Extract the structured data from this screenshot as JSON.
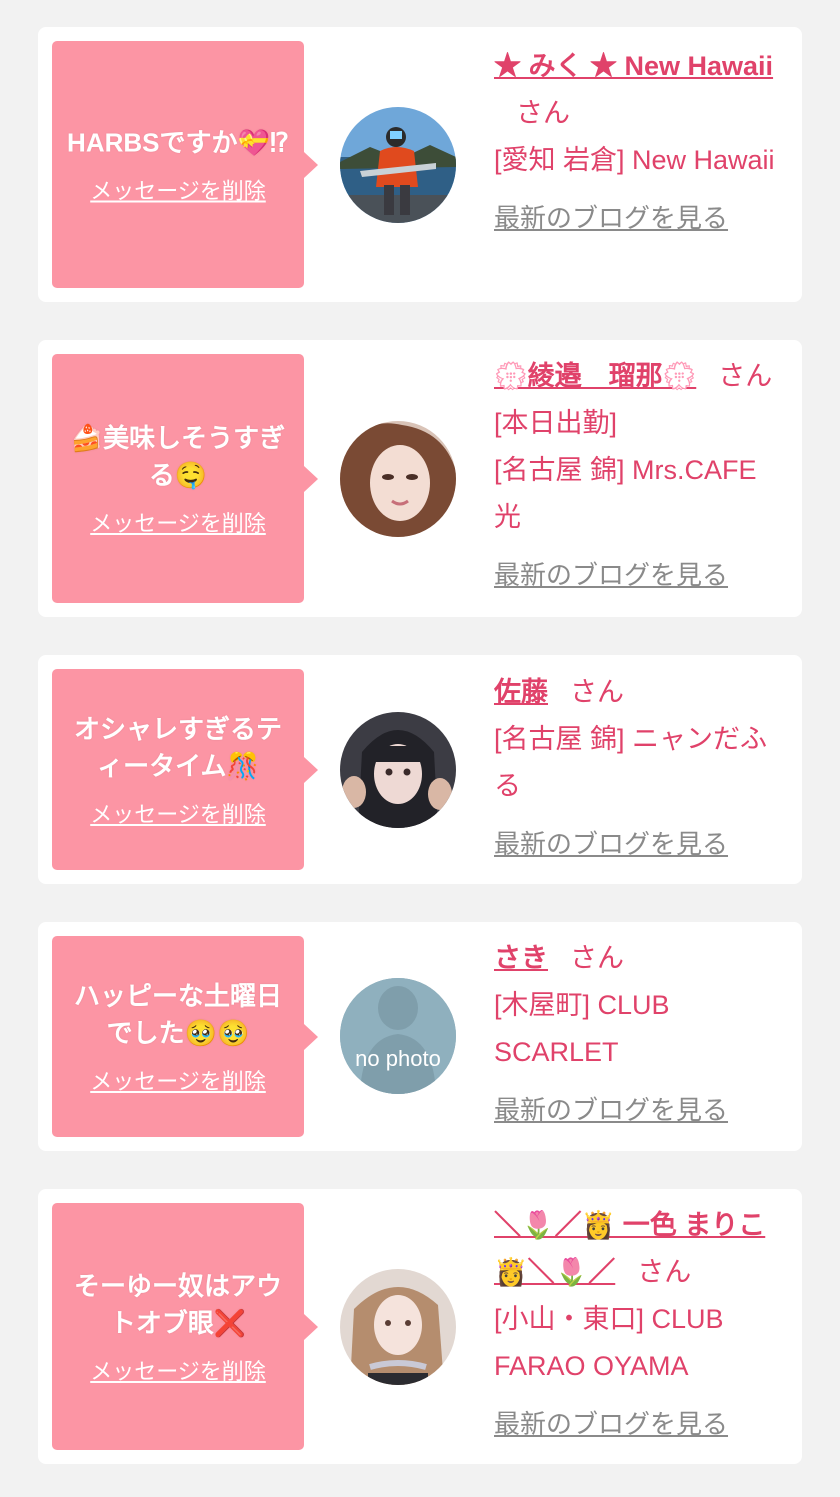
{
  "messages": [
    {
      "text": "HARBSですか💝⁉",
      "delete_label": "メッセージを削除",
      "name": "★ みく ★ New Hawaii",
      "honorific": "さん",
      "store": "[愛知 岩倉] New Hawaii",
      "blog_label": "最新のブログを見る"
    },
    {
      "text": "🍰美味しそうすぎる🤤",
      "delete_label": "メッセージを削除",
      "name": "💮綾邉　瑠那💮",
      "honorific": "さん",
      "status": "[本日出勤]",
      "store": "[名古屋 錦] Mrs.CAFE 光",
      "blog_label": "最新のブログを見る"
    },
    {
      "text": "オシャレすぎるティータイム🎊",
      "delete_label": "メッセージを削除",
      "name": "佐藤",
      "honorific": "さん",
      "store": "[名古屋 錦] ニャンだふる",
      "blog_label": "最新のブログを見る"
    },
    {
      "text": "ハッピーな土曜日でした🥹🥹",
      "delete_label": "メッセージを削除",
      "name": "さき",
      "honorific": "さん",
      "store": "[木屋町] CLUB SCARLET",
      "avatar_text": "no photo",
      "blog_label": "最新のブログを見る"
    },
    {
      "text": "そーゆー奴はアウトオブ眼❌",
      "delete_label": "メッセージを削除",
      "name": "＼🌷／👸 一色 まりこ 👸＼🌷／",
      "honorific": "さん",
      "store": "[小山・東口] CLUB FARAO OYAMA",
      "blog_label": "最新のブログを見る"
    }
  ],
  "colors": {
    "page_background": "#f2f2f2",
    "card_background": "#ffffff",
    "bubble_pink": "#fc95a4",
    "accent_pink": "#e0426a",
    "link_gray": "#8a8a8a"
  }
}
